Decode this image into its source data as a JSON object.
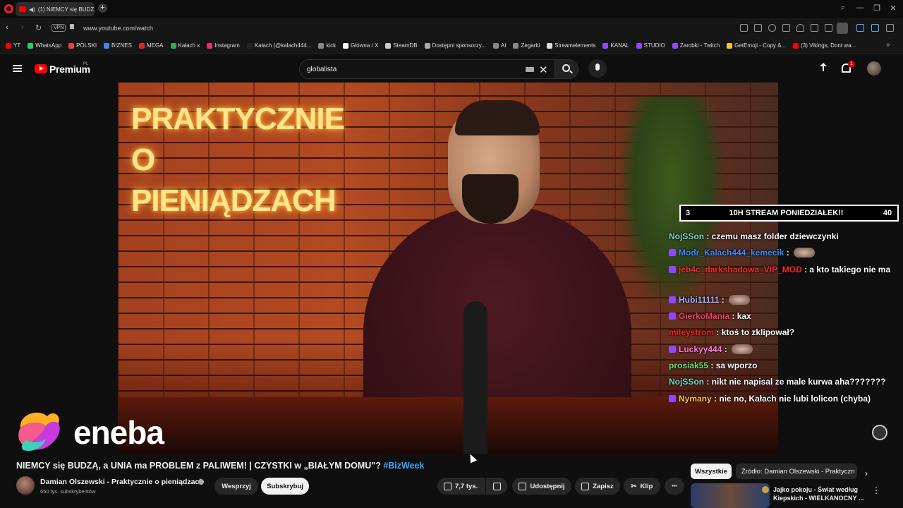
{
  "browser": {
    "tab_title": "(1) NIEMCY się BUDZĄ",
    "new_tab": "+",
    "url": "www.youtube.com/watch",
    "vpn": "VPN",
    "bookmarks": [
      {
        "label": "YT",
        "color": "#ff0000"
      },
      {
        "label": "WhatsApp",
        "color": "#25d366"
      },
      {
        "label": "POLSKI",
        "color": "#ea4335"
      },
      {
        "label": "BIZNES",
        "color": "#4285f4"
      },
      {
        "label": "MEGA",
        "color": "#d9272e"
      },
      {
        "label": "Kałach x",
        "color": "#34a853"
      },
      {
        "label": "Instagram",
        "color": "#e1306c"
      },
      {
        "label": "Kałach (@kalach444...",
        "color": "#222222"
      },
      {
        "label": "kick",
        "color": "#888888"
      },
      {
        "label": "Główna / X",
        "color": "#ffffff"
      },
      {
        "label": "SteamDB",
        "color": "#cccccc"
      },
      {
        "label": "Dostępni sponsorzy...",
        "color": "#aaaaaa"
      },
      {
        "label": "AI",
        "color": "#888888"
      },
      {
        "label": "Zegarki",
        "color": "#888888"
      },
      {
        "label": "Streamelements",
        "color": "#dddddd"
      },
      {
        "label": "KANAL",
        "color": "#9147ff"
      },
      {
        "label": "STUDIO",
        "color": "#9147ff"
      },
      {
        "label": "Zarobki - Twitch",
        "color": "#9147ff"
      },
      {
        "label": "GetEmoji - Copy &...",
        "color": "#f4c430"
      },
      {
        "label": "(3) Vikings, Dont wa...",
        "color": "#ff0000"
      }
    ],
    "more": "»"
  },
  "youtube": {
    "logo_text": "Premium",
    "region": "PL",
    "search_value": "globalista",
    "notification_count": "1"
  },
  "video": {
    "neon_line1": "PRAKTYCZNIE O",
    "neon_line2": "PIENIĄDZACH",
    "watermark": "eneba",
    "stream_bar": {
      "left_num": "3",
      "title": "10H STREAM PONIEDZIAŁEK!!",
      "right_num": "40"
    },
    "chat": [
      {
        "user": "NojSSon",
        "color": "#7fd6c8",
        "badge": false,
        "text": "czemu masz folder dziewczynki",
        "emote": false
      },
      {
        "user": "Modr_Kalach444_kemecik",
        "color": "#3a8dff",
        "badge": true,
        "text": "",
        "emote": true
      },
      {
        "user": "jeb4c_darkshadowa_VIP_MOD",
        "color": "#ff2b2b",
        "badge": true,
        "text": "a kto takiego nie ma",
        "emote": false
      },
      {
        "user": "Hubi11111",
        "color": "#9fb6ff",
        "badge": true,
        "text": "",
        "emote": true
      },
      {
        "user": "GierkoMania",
        "color": "#ff3b6b",
        "badge": true,
        "text": "kax",
        "emote": false
      },
      {
        "user": "mileystrom",
        "color": "#ff2020",
        "badge": false,
        "text": "ktoś to zklipował?",
        "emote": false
      },
      {
        "user": "Luckyy444",
        "color": "#ff7ad9",
        "badge": true,
        "text": "",
        "emote": true
      },
      {
        "user": "prosiak55",
        "color": "#6ee06e",
        "badge": false,
        "text": "sa wporzo",
        "emote": false
      },
      {
        "user": "NojSSon",
        "color": "#7fd6c8",
        "badge": false,
        "text": "nikt nie napisal ze male kurwa aha???????",
        "emote": false
      },
      {
        "user": "Nymany",
        "color": "#ffc94a",
        "badge": true,
        "text": "nie no, Kałach nie lubi lolicon (chyba)",
        "emote": false
      }
    ]
  },
  "info": {
    "title_main": "NIEMCY się BUDZĄ, a UNIA ma PROBLEM z PALIWEM! | CZYSTKI w „BIAŁYM DOMU\"? ",
    "title_tag": "#BizWeek",
    "channel_name": "Damian Olszewski - Praktycznie o pieniądzach",
    "subscribers": "650 tys. subskrybentów",
    "support": "Wesprzyj",
    "subscribe": "Subskrybuj",
    "likes": "7,7 tys.",
    "share": "Udostępnij",
    "save": "Zapisz",
    "clip": "Klip",
    "more": "•••"
  },
  "sidebar": {
    "chip_all": "Wszystkie",
    "chip_source": "Źródło: Damian Olszewski - Praktyczn",
    "rec_title": "Jajko pokoju - Świat według Kiepskich - WIELKANOCNY ..."
  }
}
